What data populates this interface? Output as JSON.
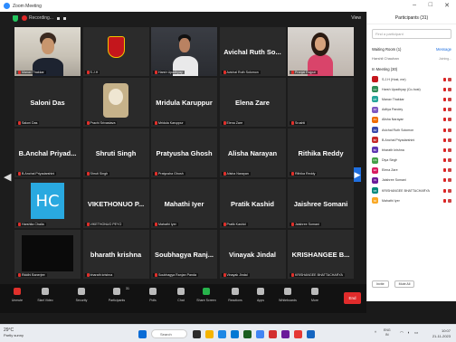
{
  "window": {
    "title": "Zoom Meeting",
    "min_glyph": "–",
    "max_glyph": "□",
    "close_glyph": "✕"
  },
  "meeting": {
    "recording_label": "Recording...",
    "view_label": "View",
    "prev_page": "◀",
    "next_page": "▶"
  },
  "tiles": [
    {
      "display": "",
      "name": "Manav Thakkar",
      "photo": "ph-1"
    },
    {
      "display": "",
      "name": "S.J.H",
      "photo": "ph-2"
    },
    {
      "display": "",
      "name": "Harsh Upadhyay",
      "photo": "ph-3"
    },
    {
      "display": "Avichal Ruth So...",
      "name": "Avichal Ruth Solomon",
      "photo": ""
    },
    {
      "display": "",
      "name": "Pranjal Rajput",
      "photo": "ph-5"
    },
    {
      "display": "Saloni Das",
      "name": "Saloni Das",
      "photo": ""
    },
    {
      "display": "",
      "name": "Prachi Srivastava",
      "photo": "ph-dog"
    },
    {
      "display": "Mridula Karuppur",
      "name": "Mridula Karuppur",
      "photo": ""
    },
    {
      "display": "Elena Zare",
      "name": "Elena Zare",
      "photo": ""
    },
    {
      "display": "",
      "name": "Srushti",
      "photo": ""
    },
    {
      "display": "B.Anchal Priyad...",
      "name": "B.Anchal Priyadarshini",
      "photo": ""
    },
    {
      "display": "Shruti Singh",
      "name": "Shruti Singh",
      "photo": ""
    },
    {
      "display": "Pratyusha Ghosh",
      "name": "Pratyusha Ghosh",
      "photo": ""
    },
    {
      "display": "Alisha Narayan",
      "name": "Alisha Narayan",
      "photo": ""
    },
    {
      "display": "Rithika Reddy",
      "name": "Rithika Reddy",
      "photo": ""
    },
    {
      "display": "",
      "name": "Harshita Chalia",
      "photo": "hc",
      "initials": "HC"
    },
    {
      "display": "VIKETHONUO P...",
      "name": "VIKETHONUO PEYO",
      "photo": ""
    },
    {
      "display": "Mahathi Iyer",
      "name": "Mahathi Iyer",
      "photo": ""
    },
    {
      "display": "Pratik Kashid",
      "name": "Pratik Kashid",
      "photo": ""
    },
    {
      "display": "Jaishree Somani",
      "name": "Jaishree Somani",
      "photo": ""
    },
    {
      "display": "",
      "name": "Riddhi Banerjee",
      "photo": "gblack"
    },
    {
      "display": "bharath krishna",
      "name": "bharath krishna",
      "photo": ""
    },
    {
      "display": "Soubhagya Ranj...",
      "name": "Soubhagya Ranjan Panda",
      "photo": ""
    },
    {
      "display": "Vinayak Jindal",
      "name": "Vinayak Jindal",
      "photo": ""
    },
    {
      "display": "KRISHANGEE B...",
      "name": "KRISHANGEE BHATTACHARYA",
      "photo": ""
    }
  ],
  "toolbar": {
    "items": [
      "Unmute",
      "Start Video",
      "Security",
      "Participants",
      "Polls",
      "Chat",
      "Share Screen",
      "Reactions",
      "Apps",
      "Whiteboards",
      "More"
    ],
    "participants_count": "31",
    "end_label": "End"
  },
  "panel": {
    "title": "Participants (31)",
    "search_placeholder": "Find a participant",
    "waiting_header": "Waiting Room (1)",
    "waiting_action": "Message",
    "waiting_person": "Harshil Chauhan",
    "waiting_status": "Joining...",
    "inmeeting_header": "In Meeting (30)",
    "participants": [
      {
        "initials": "",
        "name": "S.J.H (Host, me)",
        "color": "#c4161c"
      },
      {
        "initials": "HU",
        "name": "Harsh Upadhyay (Co-host)",
        "color": "#2e8b57"
      },
      {
        "initials": "MT",
        "name": "Manav Thakkar",
        "color": "#26a69a"
      },
      {
        "initials": "AP",
        "name": "Aditya Pandey",
        "color": "#7e57c2"
      },
      {
        "initials": "AN",
        "name": "Alisha Narayan",
        "color": "#ef6c00"
      },
      {
        "initials": "AR",
        "name": "Avichal Ruth Solomon",
        "color": "#3949ab"
      },
      {
        "initials": "BP",
        "name": "B.Anchal Priyadarshini",
        "color": "#c62828"
      },
      {
        "initials": "BK",
        "name": "bharath krishna",
        "color": "#5e35b1"
      },
      {
        "initials": "DS",
        "name": "Diya Singh",
        "color": "#43a047"
      },
      {
        "initials": "EZ",
        "name": "Elena Zare",
        "color": "#d81b60"
      },
      {
        "initials": "JS",
        "name": "Jaishree Somani",
        "color": "#6a1b9a"
      },
      {
        "initials": "KB",
        "name": "KRISHANGEE BHATTACHARYA",
        "color": "#00897b"
      },
      {
        "initials": "MI",
        "name": "Mahathi Iyer",
        "color": "#f9a825"
      }
    ],
    "invite_label": "Invite",
    "mute_all_label": "Mute All"
  },
  "taskbar": {
    "temp": "29°C",
    "weather": "Partly sunny",
    "search_label": "Search",
    "lang": "ENG",
    "region": "IN",
    "time": "10:07",
    "date": "21-11-2023"
  },
  "colors": {
    "active_border": "#9ad64a",
    "accent": "#1f6fe0",
    "mute_red": "#e0302b"
  }
}
